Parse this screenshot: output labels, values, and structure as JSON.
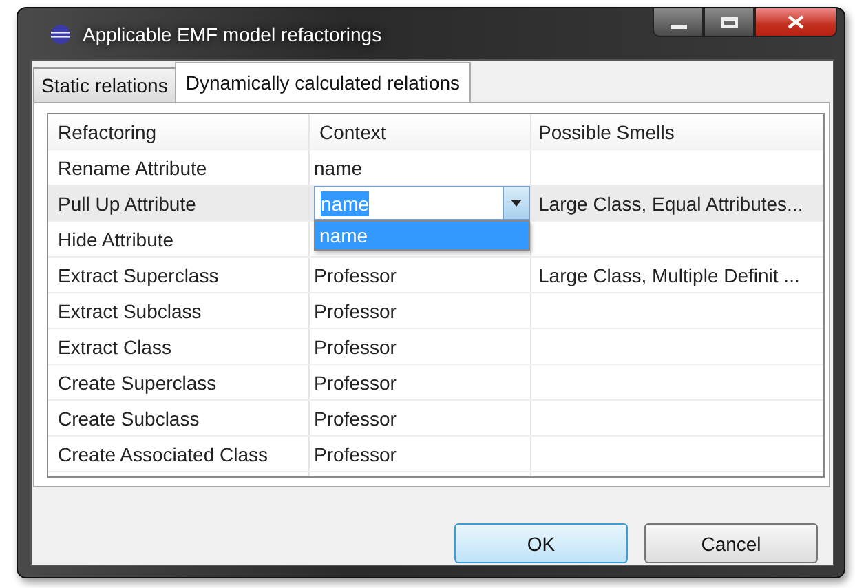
{
  "window": {
    "title": "Applicable EMF model refactorings"
  },
  "tabs": [
    {
      "label": "Static relations",
      "selected": false
    },
    {
      "label": "Dynamically calculated relations",
      "selected": true
    }
  ],
  "table": {
    "columns": [
      "Refactoring",
      "Context",
      "Possible Smells"
    ],
    "rows": [
      {
        "refactoring": "Rename Attribute",
        "context": "name",
        "smells": "",
        "selected": false
      },
      {
        "refactoring": "Pull Up Attribute",
        "context": "name",
        "smells": "Large Class, Equal Attributes...",
        "selected": true,
        "editor": {
          "kind": "combo",
          "text_selected": true,
          "dropdown": [
            {
              "label": "name",
              "selected": true
            }
          ]
        }
      },
      {
        "refactoring": "Hide Attribute",
        "context": "",
        "smells": "",
        "selected": false
      },
      {
        "refactoring": "Extract Superclass",
        "context": "Professor",
        "smells": "Large Class, Multiple Definit ...",
        "selected": false
      },
      {
        "refactoring": "Extract Subclass",
        "context": "Professor",
        "smells": "",
        "selected": false
      },
      {
        "refactoring": "Extract Class",
        "context": "Professor",
        "smells": "",
        "selected": false
      },
      {
        "refactoring": "Create Superclass",
        "context": "Professor",
        "smells": "",
        "selected": false
      },
      {
        "refactoring": "Create Subclass",
        "context": "Professor",
        "smells": "",
        "selected": false
      },
      {
        "refactoring": "Create Associated Class",
        "context": "Professor",
        "smells": "",
        "selected": false
      }
    ]
  },
  "buttons": [
    {
      "label": "OK",
      "default": true
    },
    {
      "label": "Cancel",
      "default": false
    }
  ]
}
